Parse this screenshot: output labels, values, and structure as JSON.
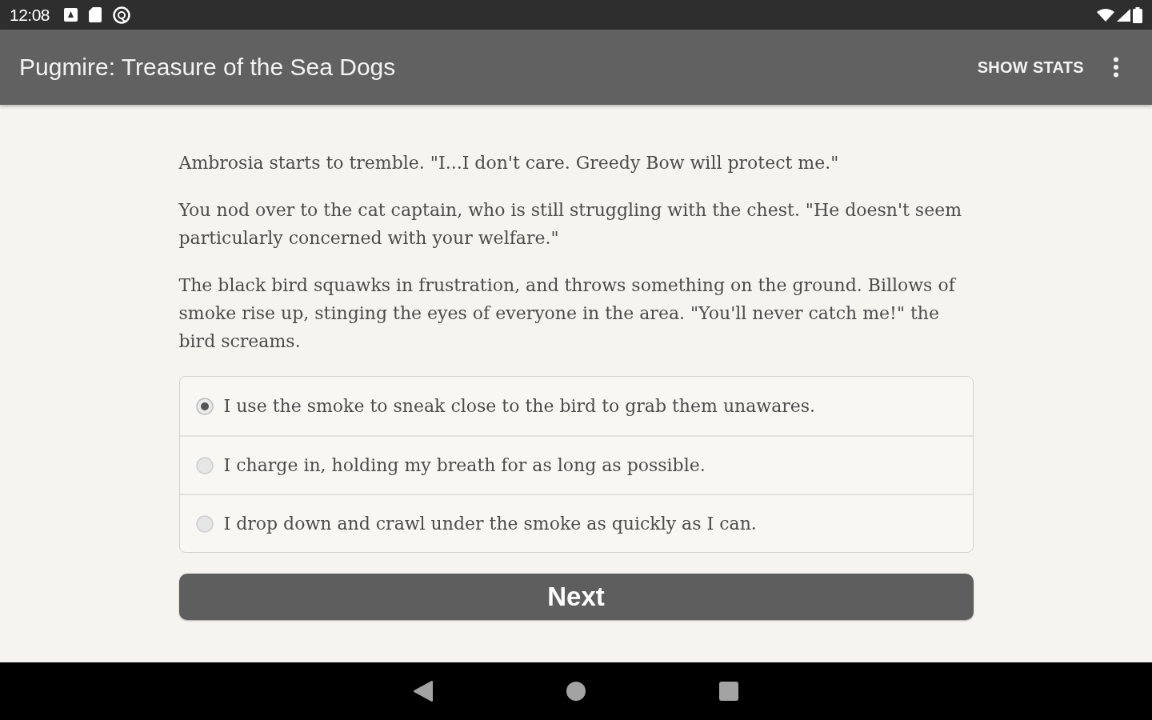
{
  "status_bar": {
    "time": "12:08"
  },
  "app_bar": {
    "title": "Pugmire: Treasure of the Sea Dogs",
    "action": "SHOW STATS"
  },
  "passage": [
    "Ambrosia starts to tremble. \"I...I don't care. Greedy Bow will protect me.\"",
    "You nod over to the cat captain, who is still struggling with the chest. \"He doesn't seem particularly concerned with your welfare.\"",
    "The black bird squawks in frustration, and throws something on the ground. Billows of smoke rise up, stinging the eyes of everyone in the area. \"You'll never catch me!\" the bird screams."
  ],
  "choices": [
    {
      "label": "I use the smoke to sneak close to the bird to grab them unawares.",
      "selected": true
    },
    {
      "label": "I charge in, holding my breath for as long as possible.",
      "selected": false
    },
    {
      "label": "I drop down and crawl under the smoke as quickly as I can.",
      "selected": false
    }
  ],
  "next_button": "Next"
}
